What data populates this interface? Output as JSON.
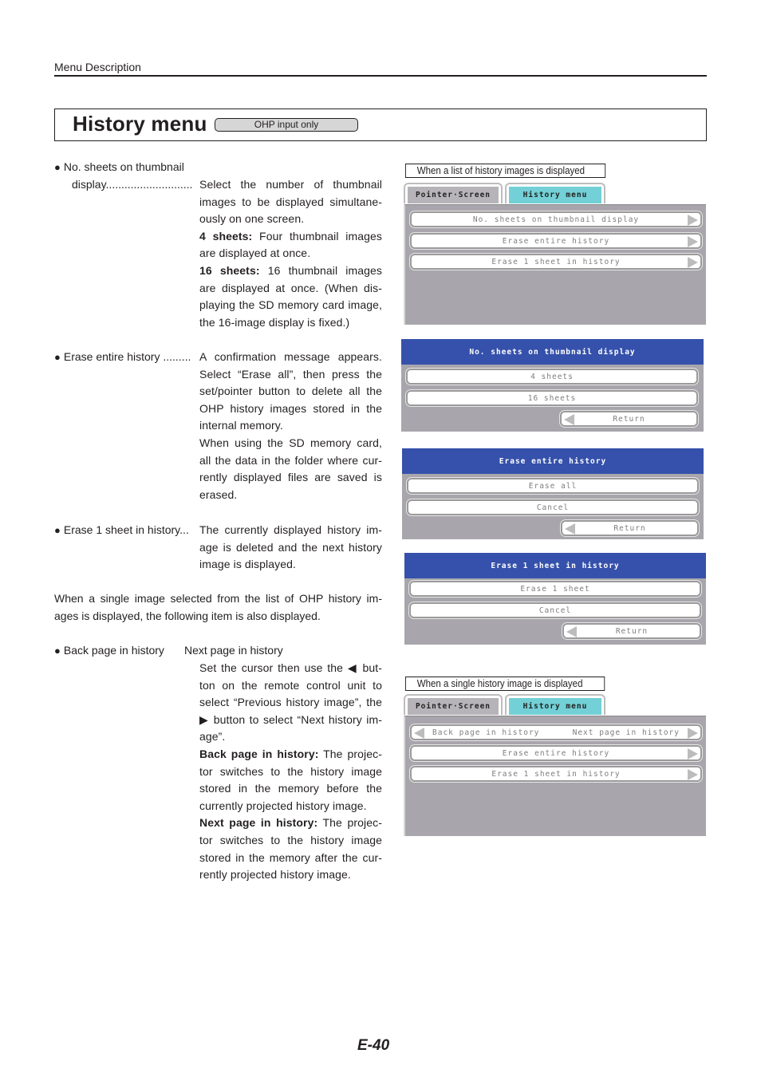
{
  "header": {
    "section_label": "Menu Description"
  },
  "title": {
    "text": "History menu",
    "badge": "OHP input only"
  },
  "items": [
    {
      "label_line1": "No. sheets on thumbnail",
      "label_line2": "display............................",
      "desc": [
        {
          "bold": "",
          "text": "Select the number of thumbnail images to be displayed simultane-ously on one screen."
        },
        {
          "bold": "4 sheets:",
          "text": " Four thumbnail images are displayed at once."
        },
        {
          "bold": "16 sheets:",
          "text": " 16 thumbnail images are displayed at once. (When dis-playing the SD memory card image, the 16-image display is fixed.)"
        }
      ]
    },
    {
      "label": "Erase entire history .........",
      "desc": [
        {
          "bold": "",
          "text": "A confirmation message appears. Select “Erase all”, then press the set/pointer button to delete all the OHP history images stored in the internal memory."
        },
        {
          "bold": "",
          "text": "When using the SD memory card, all the data in the folder where cur-rently displayed files are saved is erased."
        }
      ]
    },
    {
      "label": "Erase 1 sheet in history...",
      "desc": [
        {
          "bold": "",
          "text": "The currently displayed history im-age is deleted and the next history image is displayed."
        }
      ]
    }
  ],
  "note": "When a single image selected from the list of OHP history im-ages is displayed, the following item is also displayed.",
  "back_next": {
    "label_back": "Back page in history",
    "label_next": "Next page in history",
    "desc": [
      {
        "bold": "",
        "text": "Set the cursor then use the ◀ but-ton on the remote control unit to select “Previous history image”, the ▶ button to select “Next history im-age”."
      },
      {
        "bold": "Back page in history:",
        "text": " The projec-tor switches to the history image stored in the memory before the currently projected history image."
      },
      {
        "bold": "Next page in history:",
        "text": " The projec-tor switches to the history image stored in the memory after the cur-rently projected history image."
      }
    ]
  },
  "screens": {
    "list_caption": "When a list of history images is displayed",
    "single_caption": "When a single history image is displayed",
    "tabs": [
      "Pointer·Screen",
      "History menu"
    ],
    "list_menu": [
      "No. sheets on thumbnail display",
      "Erase entire history",
      "Erase 1 sheet in history"
    ],
    "single_menu": {
      "back": "Back page in history",
      "next": "Next page in history",
      "items": [
        "Erase entire history",
        "Erase 1 sheet in history"
      ]
    },
    "dialogs": [
      {
        "title": "No. sheets on thumbnail display",
        "options": [
          "4 sheets",
          "16 sheets"
        ],
        "return": "Return"
      },
      {
        "title": "Erase entire history",
        "options": [
          "Erase all",
          "Cancel"
        ],
        "return": "Return"
      },
      {
        "title": "Erase 1 sheet in history",
        "options": [
          "Erase 1 sheet",
          "Cancel"
        ],
        "return": "Return"
      }
    ],
    "colors": {
      "active_tab": "#72d0d6",
      "dialog_title": "#3551ab",
      "panel": "#a8a6ac"
    }
  },
  "page_number": "E-40"
}
